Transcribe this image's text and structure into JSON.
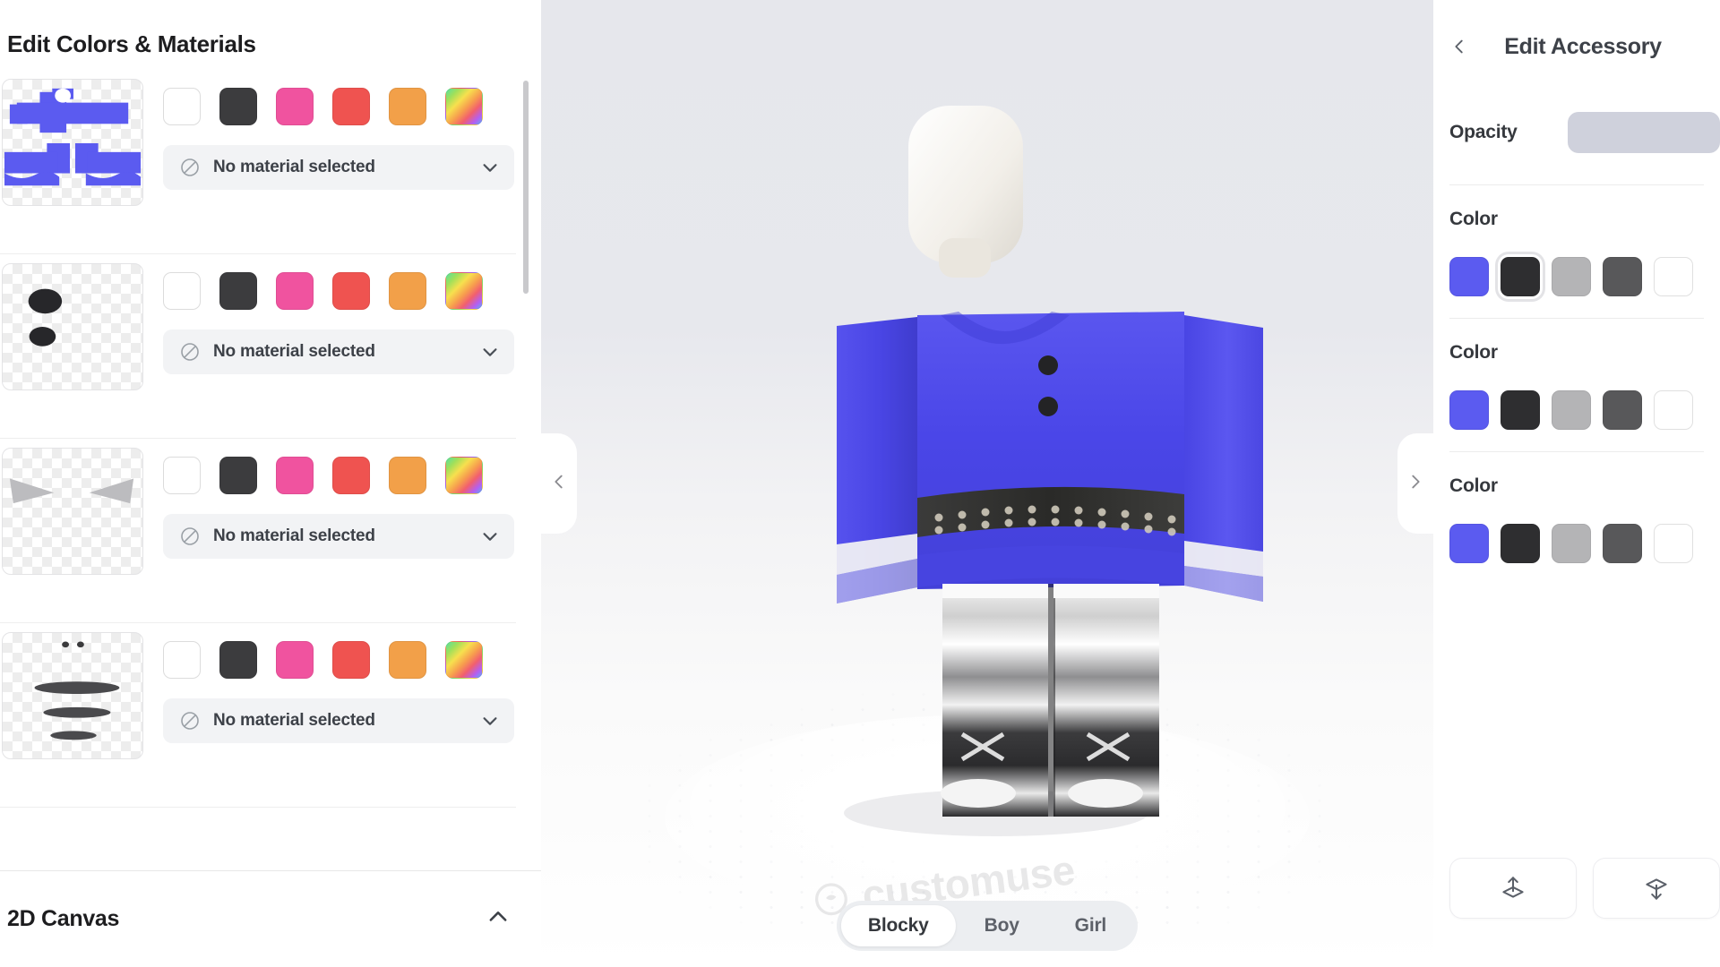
{
  "left_panel": {
    "title": "Edit Colors & Materials",
    "palette": [
      "#ffffff",
      "#3c3c3e",
      "#f0539f",
      "#ef5350",
      "#f2a049",
      "rainbow-gradient"
    ],
    "palette_names": [
      "white",
      "dark",
      "pink",
      "red",
      "orange",
      "custom-rainbow"
    ],
    "material_placeholder": "No material selected",
    "layers": [
      {
        "thumb_name": "shirt-template-thumbnail",
        "material": "No material selected"
      },
      {
        "thumb_name": "two-dots-thumbnail",
        "material": "No material selected"
      },
      {
        "thumb_name": "two-triangles-thumbnail",
        "material": "No material selected"
      },
      {
        "thumb_name": "face-mouth-thumbnail",
        "material": "No material selected"
      }
    ],
    "canvas_section": {
      "title": "2D Canvas",
      "chevron": "chevron-up-icon"
    }
  },
  "viewport": {
    "watermark": "customuse",
    "prev_arrow": "chevron-left-icon",
    "next_arrow": "chevron-right-icon",
    "body_types": [
      {
        "label": "Blocky",
        "active": true
      },
      {
        "label": "Boy",
        "active": false
      },
      {
        "label": "Girl",
        "active": false
      }
    ],
    "avatar": {
      "shirt_color": "#4a46e8",
      "trim_color": "#f2f2f2",
      "pants_color": "#2e2e30",
      "head_color": "#f4f2ee"
    }
  },
  "right_panel": {
    "title": "Edit Accessory",
    "back_icon": "chevron-left-icon",
    "opacity_label": "Opacity",
    "opacity_control": "opacity-slider",
    "color_groups": [
      {
        "label": "Color",
        "swatches": [
          "#5b5bf0",
          "#2e2e30",
          "#b4b4b6",
          "#58585a",
          "#ffffff"
        ],
        "selected_index": 1
      },
      {
        "label": "Color",
        "swatches": [
          "#5b5bf0",
          "#2e2e30",
          "#b4b4b6",
          "#58585a",
          "#ffffff"
        ],
        "selected_index": -1
      },
      {
        "label": "Color",
        "swatches": [
          "#5b5bf0",
          "#2e2e30",
          "#b4b4b6",
          "#58585a",
          "#ffffff"
        ],
        "selected_index": -1
      }
    ],
    "actions": [
      {
        "icon": "upload-icon",
        "name": "upload-button"
      },
      {
        "icon": "download-icon",
        "name": "download-button"
      }
    ]
  }
}
